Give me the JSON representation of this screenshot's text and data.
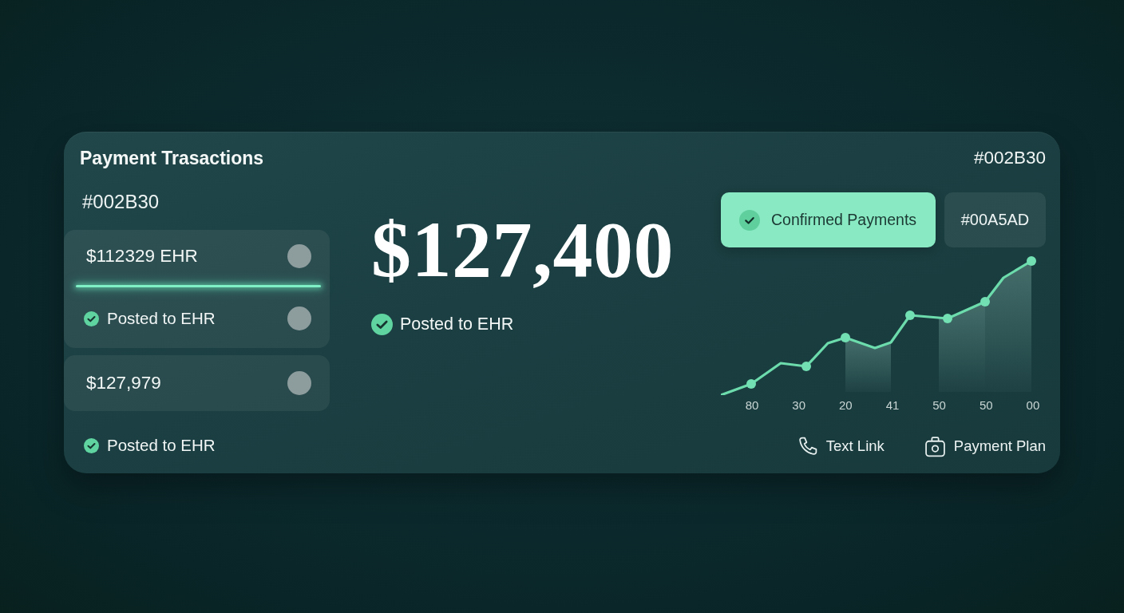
{
  "header": {
    "title": "Payment Trasactions",
    "code": "#002B30"
  },
  "transactions": {
    "code": "#002B30",
    "cards": [
      {
        "highlighted": true,
        "rows": [
          {
            "kind": "amount",
            "text": "$112329 EHR"
          },
          {
            "kind": "status",
            "text": "Posted to EHR"
          }
        ]
      },
      {
        "highlighted": false,
        "rows": [
          {
            "kind": "amount",
            "text": "$127,979"
          }
        ]
      }
    ],
    "footer_status": "Posted to EHR"
  },
  "summary": {
    "amount": "$127,400",
    "status": "Posted to EHR"
  },
  "filters": [
    {
      "label": "Confirmed Payments",
      "selected": true
    },
    {
      "label": "#00A5AD",
      "selected": false
    }
  ],
  "chart": {
    "x_labels": [
      "80",
      "30",
      "20",
      "41",
      "50",
      "50",
      "00"
    ]
  },
  "actions": [
    {
      "kind": "call",
      "label": "Text Link"
    },
    {
      "kind": "plan",
      "label": "Payment Plan"
    }
  ]
}
